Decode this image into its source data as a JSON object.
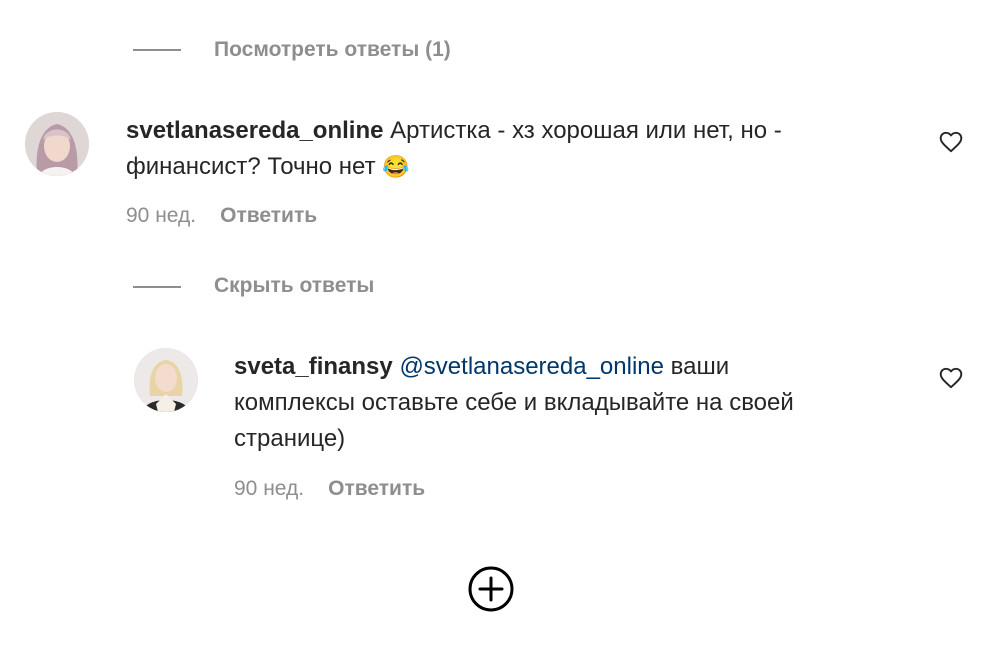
{
  "thread1": {
    "toggle_label": "Посмотреть ответы (1)"
  },
  "comment1": {
    "username": "svetlanasereda_online",
    "text": "Артистка - хз хорошая или нет, но - финансист? Точно нет",
    "emoji": "😂",
    "time": "90 нед.",
    "reply_label": "Ответить",
    "like_icon": "heart-outline"
  },
  "thread2": {
    "toggle_label": "Скрыть ответы"
  },
  "reply1": {
    "username": "sveta_finansy",
    "mention": "@svetlanasereda_online",
    "text": "ваши комплексы оставьте себе и вкладывайте на своей странице)",
    "time": "90 нед.",
    "reply_label": "Ответить",
    "like_icon": "heart-outline"
  },
  "load_more": {
    "icon": "plus-circle"
  },
  "colors": {
    "text": "#262626",
    "secondary": "#8e8e8e",
    "mention": "#00376b"
  }
}
